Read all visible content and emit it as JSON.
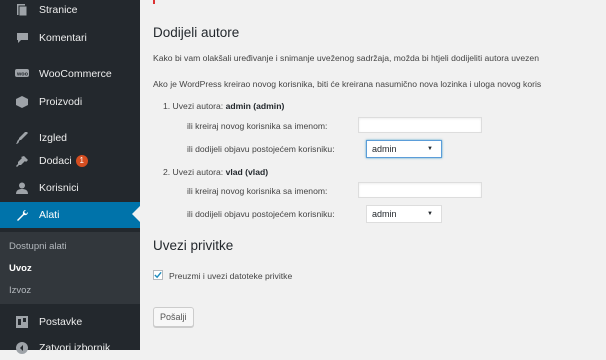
{
  "sidebar": {
    "items": [
      {
        "label": "Stranice",
        "icon": "pages-icon"
      },
      {
        "label": "Komentari",
        "icon": "comments-icon"
      },
      {
        "label": "WooCommerce",
        "icon": "woocommerce-icon"
      },
      {
        "label": "Proizvodi",
        "icon": "products-icon"
      },
      {
        "label": "Izgled",
        "icon": "appearance-icon"
      },
      {
        "label": "Dodaci",
        "icon": "plugins-icon",
        "badge": "1"
      },
      {
        "label": "Korisnici",
        "icon": "users-icon"
      },
      {
        "label": "Alati",
        "icon": "tools-icon"
      }
    ],
    "submenu": [
      "Dostupni alati",
      "Uvoz",
      "Izvoz"
    ],
    "bottom": [
      {
        "label": "Postavke",
        "icon": "settings-icon"
      },
      {
        "label": "Zatvori izbornik",
        "icon": "collapse-icon"
      }
    ]
  },
  "main": {
    "heading": "Dodijeli autore",
    "para1": "Kako bi vam olakšali uređivanje i snimanje uveženog sadržaja, možda bi htjeli dodijeliti autora uvezen",
    "para2": "Ako je WordPress kreirao novog korisnika, biti će kreirana nasumično nova lozinka i uloga novog koris",
    "authors": [
      {
        "prefix": "1. Uvezi autora: ",
        "name": "admin (admin)",
        "create_label": "ili kreiraj novog korisnika sa imenom:",
        "assign_label": "ili dodijeli objavu postojećem korisniku:",
        "selected": "admin"
      },
      {
        "prefix": "2. Uvezi autora: ",
        "name": "vlad (vlad)",
        "create_label": "ili kreiraj novog korisnika sa imenom:",
        "assign_label": "ili dodijeli objavu postojećem korisniku:",
        "selected": "admin"
      }
    ],
    "attachments_heading": "Uvezi privitke",
    "attachments_checkbox": "Preuzmi i uvezi datoteke privitke",
    "attachments_checked": true,
    "submit": "Pošalji"
  },
  "colors": {
    "sidebar_bg": "#23282d",
    "active": "#0073aa",
    "badge": "#d54e21",
    "check": "#1e8cbe"
  }
}
